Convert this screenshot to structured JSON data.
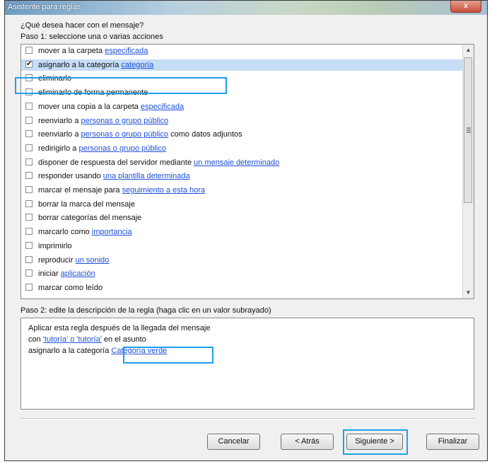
{
  "window": {
    "title": "Asistente para reglas",
    "close_label": "x"
  },
  "question": "¿Qué desea hacer con el mensaje?",
  "step1_label": "Paso 1: seleccione una o varias acciones",
  "actions": [
    {
      "text": "mover a la carpeta ",
      "link": "especificada",
      "after": "",
      "checked": false,
      "selected": false
    },
    {
      "text": "asignarlo a la categoría ",
      "link": "categoría",
      "after": "",
      "checked": true,
      "selected": true
    },
    {
      "text": "eliminarlo",
      "link": "",
      "after": "",
      "checked": false,
      "selected": false
    },
    {
      "text": "eliminarlo de forma permanente",
      "link": "",
      "after": "",
      "checked": false,
      "selected": false
    },
    {
      "text": "mover una copia a la carpeta ",
      "link": "especificada",
      "after": "",
      "checked": false,
      "selected": false
    },
    {
      "text": "reenviarlo a ",
      "link": "personas o grupo público",
      "after": "",
      "checked": false,
      "selected": false
    },
    {
      "text": "reenviarlo a ",
      "link": "personas o grupo público",
      "after": " como datos adjuntos",
      "checked": false,
      "selected": false
    },
    {
      "text": "redirigirlo a ",
      "link": "personas o grupo público",
      "after": "",
      "checked": false,
      "selected": false
    },
    {
      "text": "disponer de respuesta del servidor mediante ",
      "link": "un mensaje determinado",
      "after": "",
      "checked": false,
      "selected": false
    },
    {
      "text": "responder usando ",
      "link": "una plantilla determinada",
      "after": "",
      "checked": false,
      "selected": false
    },
    {
      "text": "marcar el mensaje para ",
      "link": "seguimiento a esta hora",
      "after": "",
      "checked": false,
      "selected": false
    },
    {
      "text": "borrar la marca del mensaje",
      "link": "",
      "after": "",
      "checked": false,
      "selected": false
    },
    {
      "text": "borrar categorías del mensaje",
      "link": "",
      "after": "",
      "checked": false,
      "selected": false
    },
    {
      "text": "marcarlo como ",
      "link": "importancia",
      "after": "",
      "checked": false,
      "selected": false
    },
    {
      "text": "imprimirlo",
      "link": "",
      "after": "",
      "checked": false,
      "selected": false
    },
    {
      "text": "reproducir ",
      "link": "un sonido",
      "after": "",
      "checked": false,
      "selected": false
    },
    {
      "text": "iniciar ",
      "link": "aplicación",
      "after": "",
      "checked": false,
      "selected": false
    },
    {
      "text": "marcar como leído",
      "link": "",
      "after": "",
      "checked": false,
      "selected": false
    }
  ],
  "step2_label": "Paso 2: edite la descripción de la regla (haga clic en un valor subrayado)",
  "description": {
    "line1": "Aplicar esta regla después de la llegada del mensaje",
    "line2_pre": "con ",
    "line2_link": "'tutoría' o 'tutoría'",
    "line2_post": " en el asunto",
    "line3_pre": "asignarlo a la categoría ",
    "line3_link": "Categoría verde"
  },
  "buttons": {
    "cancel": "Cancelar",
    "back": "< Atrás",
    "next": "Siguiente >",
    "finish": "Finalizar"
  },
  "colors": {
    "highlight": "#1ea0ea",
    "link": "#1f4fd6",
    "selected_row": "#c5ddf6"
  }
}
